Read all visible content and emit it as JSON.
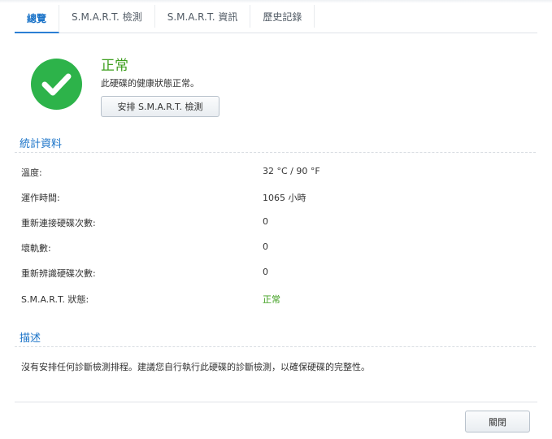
{
  "tabs": [
    {
      "label": "總覽",
      "active": true
    },
    {
      "label": "S.M.A.R.T. 檢測",
      "active": false
    },
    {
      "label": "S.M.A.R.T. 資訊",
      "active": false
    },
    {
      "label": "歷史記錄",
      "active": false
    }
  ],
  "status": {
    "icon": "check-circle-icon",
    "title": "正常",
    "description": "此硬碟的健康狀態正常。",
    "schedule_button": "安排 S.M.A.R.T. 檢測"
  },
  "statistics": {
    "title": "統計資料",
    "rows": [
      {
        "label": "溫度:",
        "value": "32 °C / 90 °F"
      },
      {
        "label": "運作時間:",
        "value": "1065 小時"
      },
      {
        "label": "重新連接硬碟次數:",
        "value": "0"
      },
      {
        "label": "壞軌數:",
        "value": "0"
      },
      {
        "label": "重新辨識硬碟次數:",
        "value": "0"
      },
      {
        "label": "S.M.A.R.T. 狀態:",
        "value": "正常"
      }
    ]
  },
  "description": {
    "title": "描述",
    "text": "沒有安排任何診斷檢測排程。建議您自行執行此硬碟的診斷檢測，以確保硬碟的完整性。"
  },
  "footer": {
    "close_button": "關閉"
  },
  "colors": {
    "accent": "#1a73c8",
    "ok": "#3f9f1f",
    "icon_green": "#2db34a"
  }
}
